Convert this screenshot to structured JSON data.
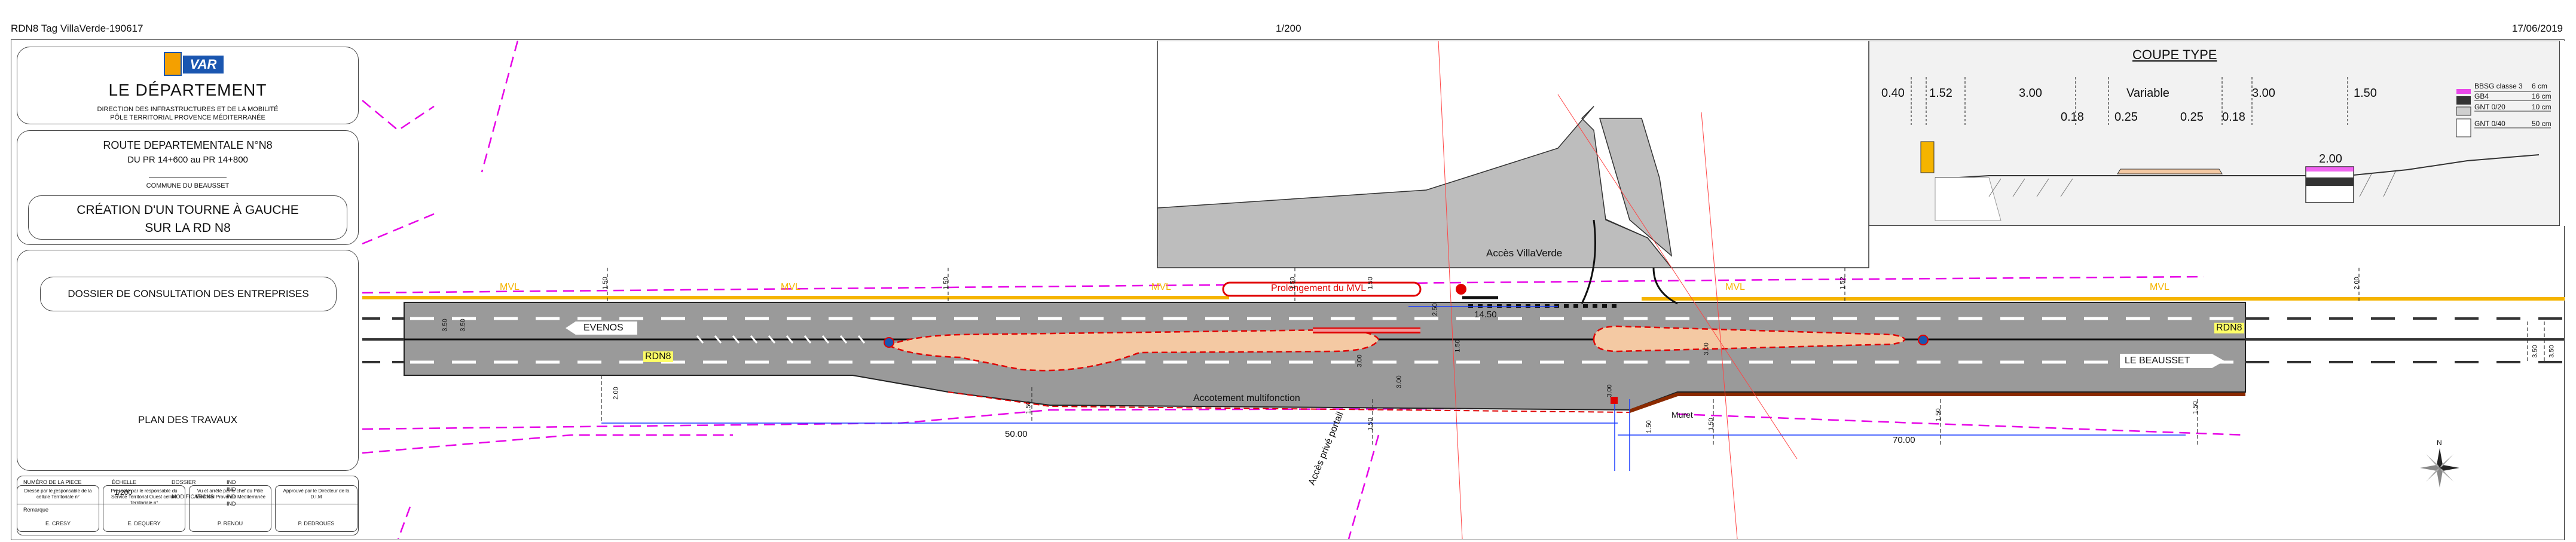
{
  "header": {
    "file_name": "RDN8 Tag VillaVerde-190617",
    "scale": "1/200",
    "date": "17/06/2019"
  },
  "cartouche": {
    "logo_text": "VAR",
    "logo_subtitle": "LE DÉPARTEMENT",
    "direction_line1": "DIRECTION DES INFRASTRUCTURES ET DE LA MOBILITÉ",
    "direction_line2": "PÔLE TERRITORIAL PROVENCE MÉDITERRANÉE",
    "route_title": "ROUTE DEPARTEMENTALE N°N8",
    "route_pr": "DU PR 14+600 au PR 14+800",
    "commune": "COMMUNE DU BEAUSSET",
    "project_line1": "CRÉATION D'UN TOURNE À GAUCHE",
    "project_line2": "SUR LA RD N8",
    "dossier": "DOSSIER DE CONSULTATION DES ENTREPRISES",
    "plan_title": "PLAN DES TRAVAUX",
    "numero_label": "NUMÉRO DE LA PIECE",
    "numero_value": "-",
    "echelle_label": "ÉCHELLE",
    "echelle_value": "1/200",
    "dossier_label": "DOSSIER",
    "modifications_label": "MODIFICATIONS",
    "indices": [
      "IND",
      "IND",
      "IND",
      "IND"
    ],
    "remarque_label": "Remarque",
    "sign_labels": [
      "Dressé par le responsable de la cellule Territoriale n°",
      "Présenté par le responsable du Service Territorial Ouest cellule Territoriale n°",
      "Vu et arrêté par le chef du Pôle Territorial Provence Méditerranée",
      "Approuvé par le Directeur de la D.I.M"
    ],
    "sign_names": [
      "E. CRESY",
      "E. DEQUERY",
      "P. RENOU",
      "P. DEDROUES"
    ]
  },
  "plan": {
    "labels": {
      "acces_villaverde": "Accès VillaVerde",
      "prolongement": "Prolongement du MVL",
      "mvl": "MVL",
      "evenos": "EVENOS",
      "le_beausset": "LE BEAUSSET",
      "rdn8": "RDN8",
      "accotement": "Accotement multifonction",
      "muret": "Muret",
      "acces_prive": "Accès privé portail",
      "dim_1450": "14.50",
      "dim_5000": "50.00",
      "dim_7000": "70.00"
    },
    "dims": [
      "1.50",
      "1.50",
      "1.50",
      "1.50",
      "1.52",
      "2.00",
      "3.00",
      "3.00",
      "3.00",
      "3.00",
      "1.50",
      "3.50",
      "3.50",
      "3.50",
      "3.50",
      "2.00",
      "1.50",
      "1.50",
      "1.50",
      "1.50",
      "1.50",
      "1.50",
      "2.50"
    ],
    "colors": {
      "road": "#9a9a9a",
      "island": "#f4c9a3",
      "mvl": "#f5b400",
      "limit": "#e600e6",
      "red": "#e00000",
      "muret": "#8b2a00",
      "building": "#bdbdbd"
    }
  },
  "coupe": {
    "title": "COUPE TYPE",
    "top_dims": [
      "0.40",
      "1.52",
      "3.00",
      "Variable",
      "3.00",
      "1.50"
    ],
    "sub_dims": [
      "0.18",
      "0.25",
      "0.25",
      "0.18"
    ],
    "dim_200": "2.00",
    "legend": [
      {
        "name": "BBSG classe 3",
        "thickness": "6 cm"
      },
      {
        "name": "GB4",
        "thickness": "16 cm"
      },
      {
        "name": "GNT 0/20",
        "thickness": "10 cm"
      },
      {
        "name": "GNT 0/40",
        "thickness": "50 cm"
      }
    ]
  },
  "north": {
    "label": "N"
  }
}
